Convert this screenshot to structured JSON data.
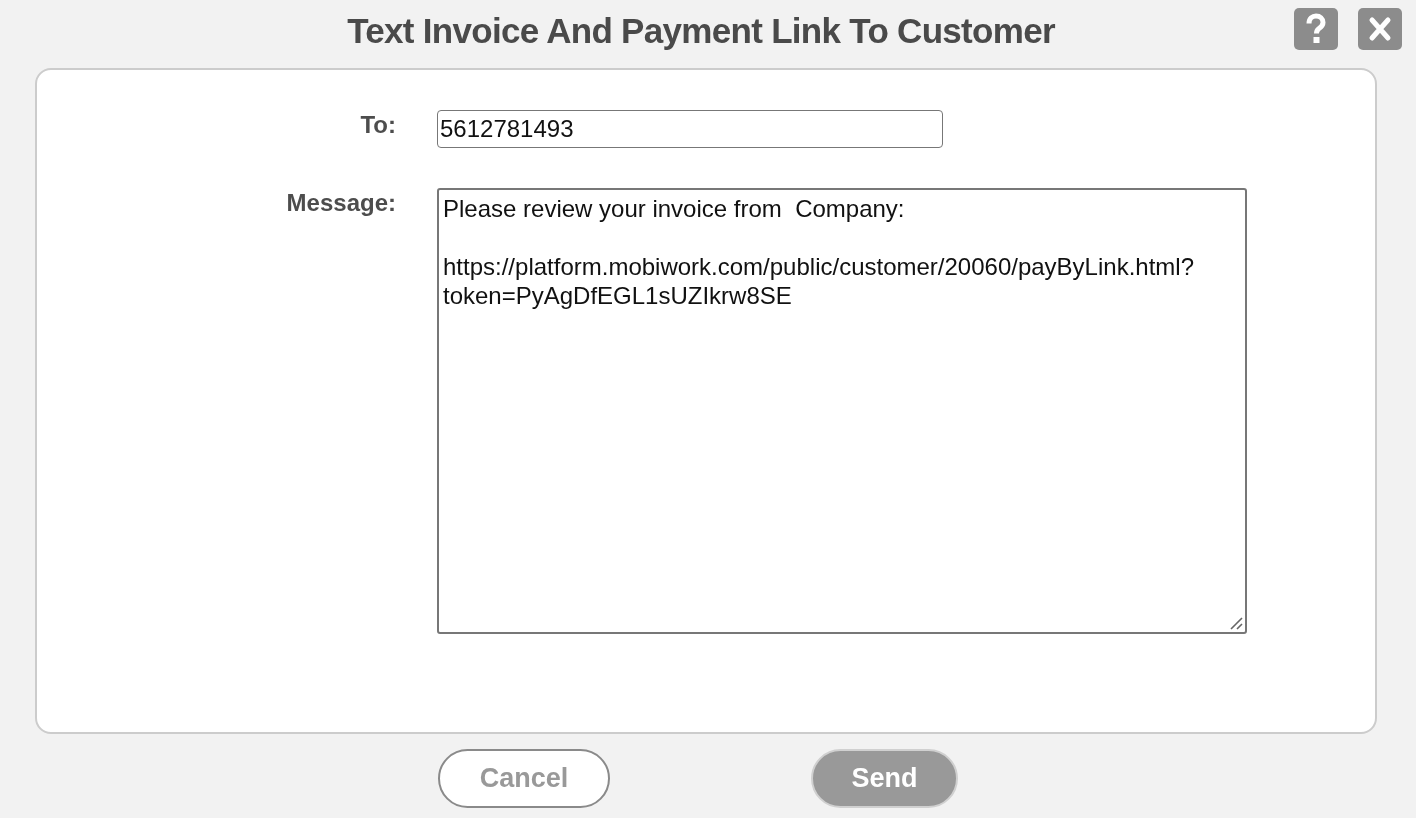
{
  "dialog": {
    "title": "Text Invoice And Payment Link To Customer"
  },
  "form": {
    "fields": [
      {
        "kind": "input",
        "label": "To:",
        "value": "5612781493"
      },
      {
        "kind": "textarea",
        "label": "Message:",
        "value": "Please review your invoice from  Company:\n\nhttps://platform.mobiwork.com/public/customer/20060/payByLink.html?token=PyAgDfEGL1sUZIkrw8SE"
      }
    ]
  },
  "buttons": [
    {
      "label": "Cancel",
      "kind": "secondary"
    },
    {
      "label": "Send",
      "kind": "primary"
    }
  ]
}
